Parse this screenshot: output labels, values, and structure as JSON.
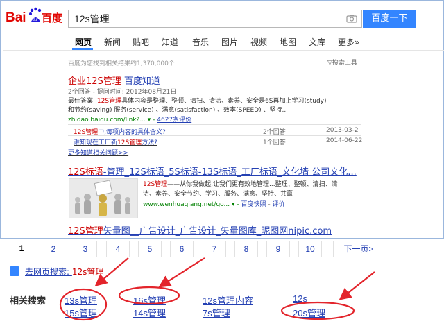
{
  "logo": {
    "text": "Bai百度",
    "du": "du"
  },
  "search": {
    "value": "12s管理",
    "button_label": "百度一下"
  },
  "tabs": [
    "网页",
    "新闻",
    "贴吧",
    "知道",
    "音乐",
    "图片",
    "视频",
    "地图",
    "文库",
    "更多»"
  ],
  "stat_text": "百度为您找到相关结果约1,370,000个",
  "tools_label": "搜索工具",
  "result1": {
    "title_em": "企业12S管理",
    "title_rest": " 百度知道",
    "meta": "2个回答 - 提问时间: 2012年08月21日",
    "answer_prefix": "最佳答案: ",
    "answer_em": "12S管理",
    "answer_rest": "具体内容是整理、整顿、清扫、清洁、素养、安全是6S再加上学习(study)",
    "answer_line2": "和节约(saving) 服务(service) 、满意(satisfaction) 、效率(SPEED) 、坚持...",
    "url": "zhidao.baidu.com/link?...",
    "rating": "4627条评价",
    "questions": [
      {
        "prefix": "",
        "em": "12S管理",
        "rest": "中,每项内容的具体含义?",
        "count": "2个回答",
        "date": "2013-03-2"
      },
      {
        "prefix": "谁知现在工厂新",
        "em": "12S管理",
        "rest": "方法?",
        "count": "1个回答",
        "date": "2014-06-22"
      }
    ],
    "more": "更多知道相关问题>>"
  },
  "result2": {
    "title_em": "12S标语",
    "title_rest": "-管理_12S标语_5S标语-13S标语_工厂标语_文化墙 公司文化...",
    "desc_em": "12S管理",
    "desc_line1": "——从你我做起,让我们更有效地管理...整理、整顿、清扫、清",
    "desc_line2": "洁、素养、安全节约、学习、服务、满意、坚持、共赢",
    "url": "www.wenhuaqiang.net/go...",
    "snapshot": "百度快照",
    "review": "评价"
  },
  "result3": {
    "title_em": "12S管理",
    "title_rest": "矢量图__广告设计_广告设计_矢量图库_昵图网nipic.com"
  },
  "pager": {
    "pages": [
      "1",
      "2",
      "3",
      "4",
      "5",
      "6",
      "7",
      "8",
      "9",
      "10"
    ],
    "next": "下一页>"
  },
  "web_search": {
    "prefix": "去网页搜索: ",
    "query": "12s管理"
  },
  "related": {
    "label": "相关搜索",
    "items": [
      "13s管理",
      "16s管理",
      "12s管理内容",
      "12s",
      "15s管理",
      "14s管理",
      "7s管理",
      "20s管理"
    ]
  },
  "colors": {
    "accent": "#3385ff",
    "link": "#2440b3",
    "emphasis": "#c00000",
    "annotation": "#e3242b"
  }
}
